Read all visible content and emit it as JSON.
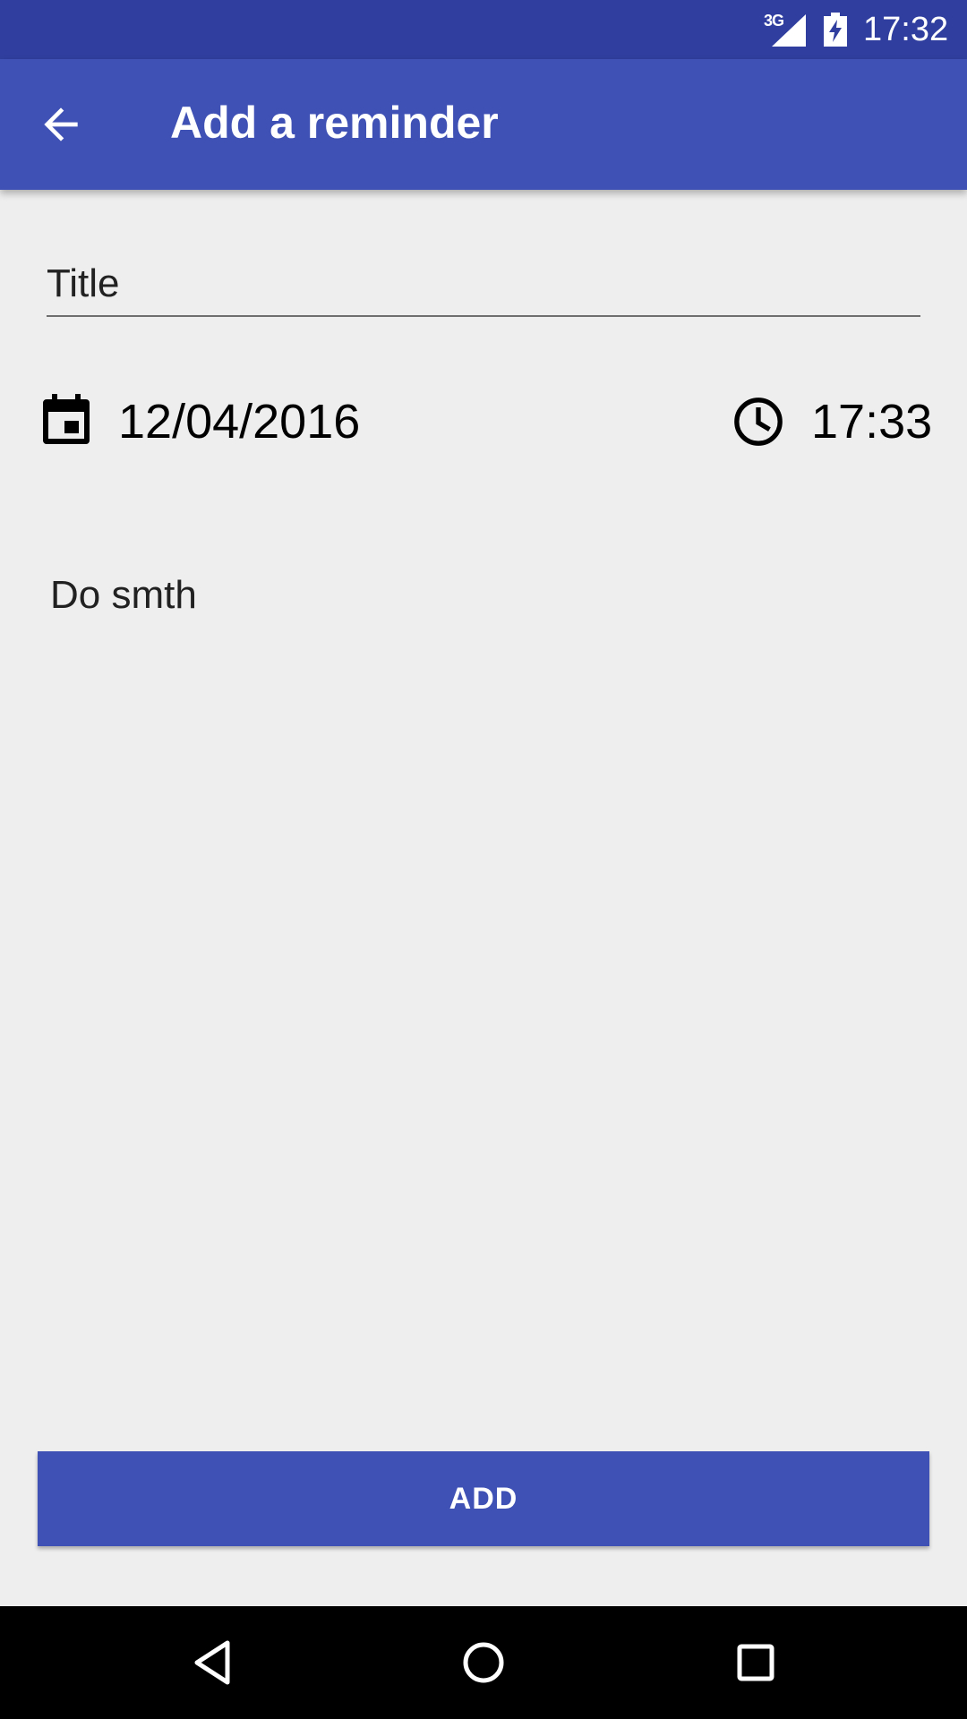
{
  "status_bar": {
    "network_type": "3G",
    "time": "17:32"
  },
  "app_bar": {
    "back_icon": "arrow-back-icon",
    "title": "Add a reminder"
  },
  "form": {
    "title_placeholder": "Title",
    "title_value": "",
    "date_icon": "calendar-icon",
    "date": "12/04/2016",
    "time_icon": "clock-icon",
    "time": "17:33",
    "description": "Do smth",
    "add_label": "ADD"
  },
  "nav_bar": {
    "back_icon": "nav-back-icon",
    "home_icon": "nav-home-icon",
    "recents_icon": "nav-recents-icon"
  },
  "colors": {
    "status_bar": "#303F9F",
    "primary": "#3F51B5",
    "background": "#EEEEEE",
    "nav_bar": "#000000"
  }
}
